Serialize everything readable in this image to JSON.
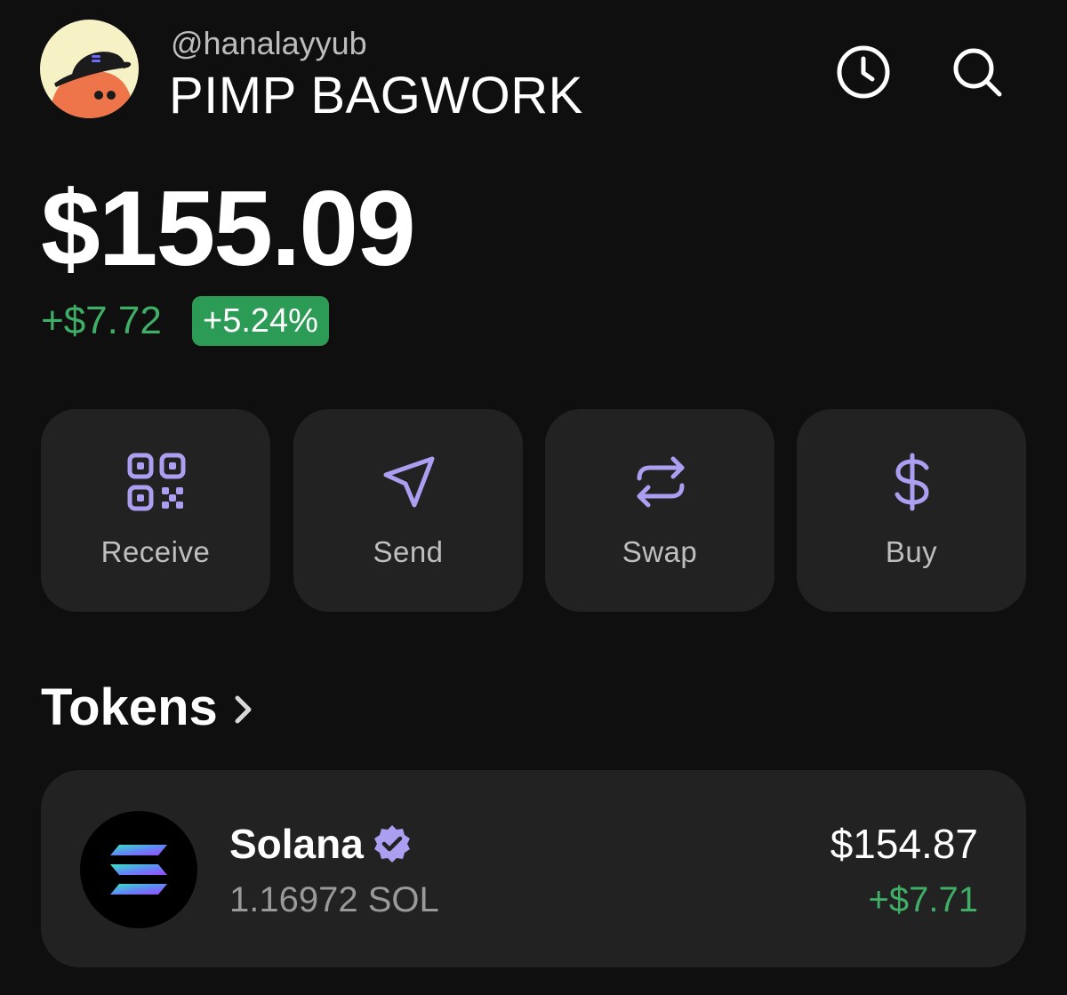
{
  "header": {
    "handle": "@hanalayyub",
    "account_name": "PIMP BAGWORK",
    "history_icon": "clock-icon",
    "search_icon": "search-icon"
  },
  "portfolio": {
    "balance": "$155.09",
    "change_amount": "+$7.72",
    "change_percent": "+5.24%"
  },
  "actions": [
    {
      "label": "Receive",
      "icon": "qr-code-icon"
    },
    {
      "label": "Send",
      "icon": "send-icon"
    },
    {
      "label": "Swap",
      "icon": "swap-icon"
    },
    {
      "label": "Buy",
      "icon": "dollar-icon"
    }
  ],
  "tokens": {
    "heading": "Tokens",
    "items": [
      {
        "name": "Solana",
        "amount": "1.16972 SOL",
        "value": "$154.87",
        "change": "+$7.71",
        "verified": true
      }
    ]
  },
  "colors": {
    "background": "#0f0f0f",
    "card": "#222222",
    "accent": "#ab9ff2",
    "positive": "#3fae66",
    "badge": "#2c9b55"
  }
}
